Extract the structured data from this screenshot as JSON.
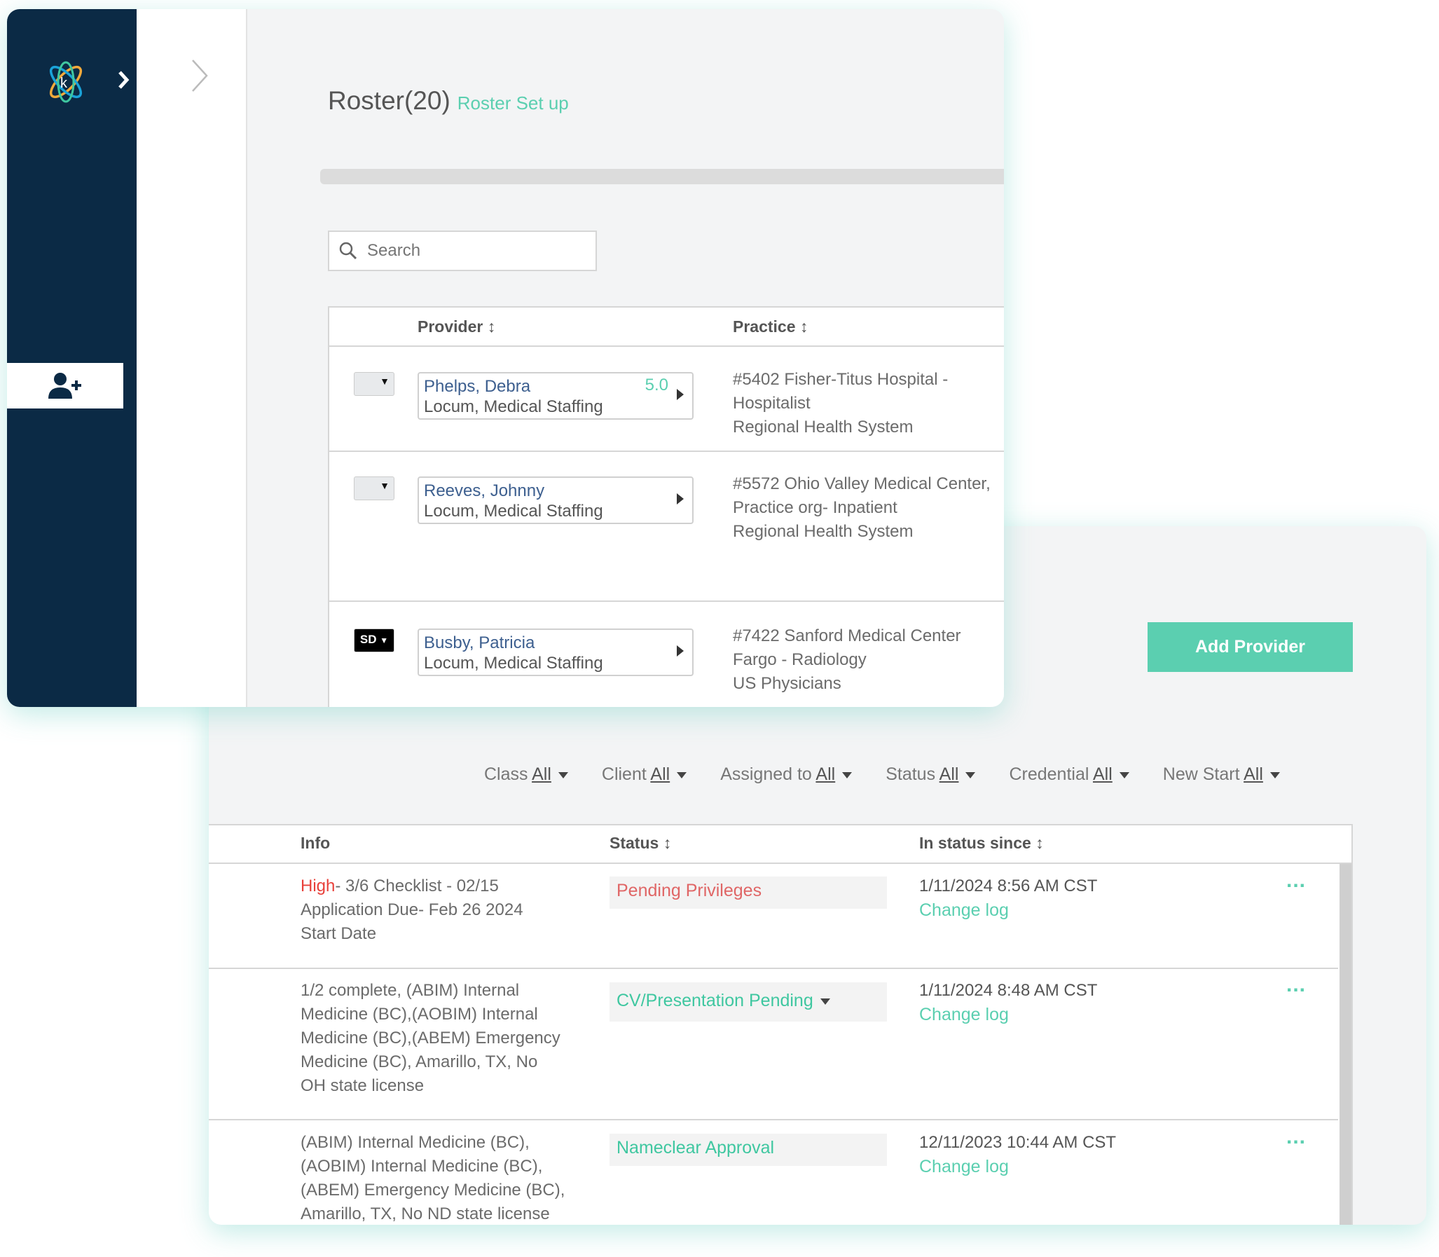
{
  "sidebar": {
    "logo": "atom-logo",
    "expand_icon": "chevron-right-icon",
    "add_user_icon": "user-plus-icon"
  },
  "roster": {
    "title": "Roster(20)",
    "setup_link": "Roster Set up",
    "search_placeholder": "Search",
    "columns": {
      "provider": "Provider",
      "practice": "Practice"
    },
    "rows": [
      {
        "tag": "",
        "name": "Phelps, Debra",
        "type": "Locum, Medical Staffing",
        "score": "5.0",
        "practice": [
          "#5402 Fisher-Titus Hospital -",
          "Hospitalist",
          "Regional Health System"
        ]
      },
      {
        "tag": "",
        "name": "Reeves, Johnny",
        "type": "Locum, Medical Staffing",
        "score": "",
        "practice": [
          "#5572 Ohio Valley Medical Center,",
          "Practice org- Inpatient",
          "Regional Health System"
        ]
      },
      {
        "tag": "SD",
        "name": "Busby, Patricia",
        "type": "Locum, Medical Staffing",
        "score": "",
        "practice": [
          "#7422 Sanford Medical Center",
          "Fargo - Radiology",
          "US Physicians"
        ]
      }
    ]
  },
  "detail": {
    "add_provider": "Add Provider",
    "filters": [
      {
        "label": "Class",
        "value": "All"
      },
      {
        "label": "Client",
        "value": "All"
      },
      {
        "label": "Assigned to",
        "value": "All"
      },
      {
        "label": "Status",
        "value": "All"
      },
      {
        "label": "Credential",
        "value": "All"
      },
      {
        "label": "New Start",
        "value": "All"
      }
    ],
    "columns": {
      "info": "Info",
      "status": "Status",
      "since": "In status since"
    },
    "rows": [
      {
        "priority": "High",
        "info": [
          "- 3/6 Checklist - 02/15",
          "Application Due- Feb 26 2024",
          "Start Date"
        ],
        "status": "Pending Privileges",
        "status_color": "#e06666",
        "since": "1/11/2024 8:56 AM CST",
        "change_log": "Change log",
        "more": "..."
      },
      {
        "priority": "",
        "info": [
          "1/2 complete, (ABIM) Internal",
          "Medicine (BC),(AOBIM) Internal",
          "Medicine (BC),(ABEM) Emergency",
          "Medicine (BC), Amarillo, TX, No",
          "OH state license"
        ],
        "status": "CV/Presentation Pending",
        "status_color": "#3fc7a0",
        "since": "1/11/2024 8:48 AM CST",
        "change_log": "Change log",
        "more": "..."
      },
      {
        "priority": "",
        "info": [
          "(ABIM) Internal Medicine (BC),",
          "(AOBIM) Internal Medicine (BC),",
          "(ABEM) Emergency Medicine (BC),",
          "Amarillo, TX, No ND state license"
        ],
        "status": "Nameclear Approval",
        "status_color": "#3fc7a0",
        "since": "12/11/2023 10:44 AM CST",
        "change_log": "Change log",
        "more": "..."
      }
    ]
  },
  "colors": {
    "navy": "#0b2a45",
    "accent": "#5bcfb0",
    "link": "#3d5f8f",
    "high": "#e8403a"
  }
}
